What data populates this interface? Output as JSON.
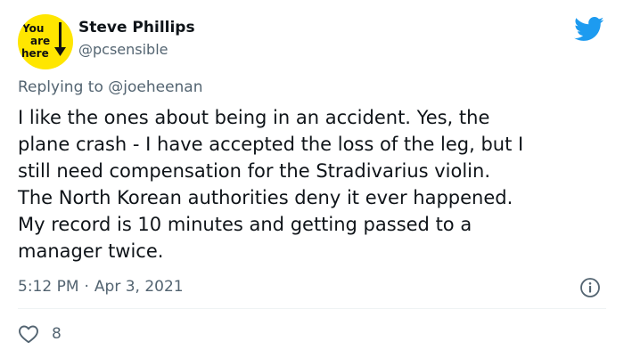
{
  "author": {
    "avatar_text": [
      "You",
      "are",
      "here"
    ],
    "display_name": "Steve Phillips",
    "handle": "@pcsensible"
  },
  "reply": {
    "prefix": "Replying to",
    "mention": "@joeheenan"
  },
  "tweet": {
    "lines": [
      "I like the ones about being in an accident. Yes, the",
      "plane crash - I have accepted the loss of the leg, but I",
      "still need compensation for the Stradivarius violin.",
      "The North Korean authorities deny it ever happened.",
      "My record is 10 minutes and getting passed to a",
      "manager twice."
    ]
  },
  "meta": {
    "time": "5:12 PM",
    "separator": "·",
    "date": "Apr 3, 2021"
  },
  "engagement": {
    "likes": "8"
  },
  "icons": {
    "brand": "twitter-bird-icon",
    "info": "info-icon",
    "like": "heart-icon"
  },
  "colors": {
    "brand_blue": "#1d9bf0",
    "avatar_yellow": "#ffe600",
    "secondary_text": "#536471",
    "primary_text": "#0f1419"
  }
}
